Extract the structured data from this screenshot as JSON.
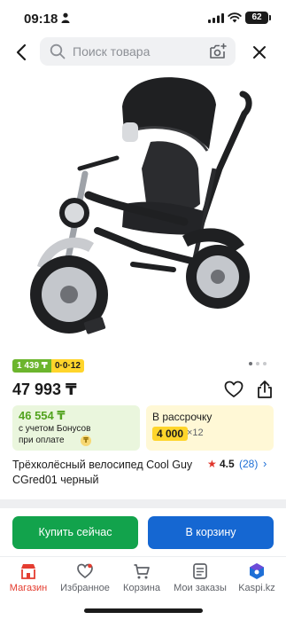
{
  "status_bar": {
    "time": "09:18",
    "battery": "62"
  },
  "search": {
    "placeholder": "Поиск товара"
  },
  "icons": {
    "back": "chevron-left-icon",
    "search": "search-icon",
    "camera": "camera-icon",
    "close": "close-icon",
    "favorite": "heart-icon",
    "share": "share-icon"
  },
  "gallery": {
    "slides": 3,
    "active": 1
  },
  "badges": {
    "bonus": "1 439 ₸",
    "installment": "0·0·12"
  },
  "product": {
    "price": "47 993 ₸",
    "title": "Трёхколёсный велосипед Cool Guy CGred01 черный",
    "rating": "4.5",
    "reviews": "(28)"
  },
  "bonus_offer": {
    "price": "46 554 ₸",
    "line1": "с учетом Бонусов",
    "line2": "при оплате"
  },
  "installment_offer": {
    "title": "В рассрочку",
    "amount": "4 000",
    "months": "×12"
  },
  "actions": {
    "buy_now": "Купить сейчас",
    "add_to_cart": "В корзину"
  },
  "tabs": [
    {
      "label": "Магазин",
      "icon": "shop-icon",
      "active": true
    },
    {
      "label": "Избранное",
      "icon": "heart-icon"
    },
    {
      "label": "Корзина",
      "icon": "cart-icon"
    },
    {
      "label": "Мои заказы",
      "icon": "orders-icon"
    },
    {
      "label": "Kaspi.kz",
      "icon": "kaspi-app-icon"
    }
  ],
  "colors": {
    "accent_red": "#e43d30",
    "buy_green": "#12a34c",
    "cart_blue": "#1567d2",
    "bonus_green": "#52a31f",
    "installment_yellow": "#ffd52b"
  }
}
